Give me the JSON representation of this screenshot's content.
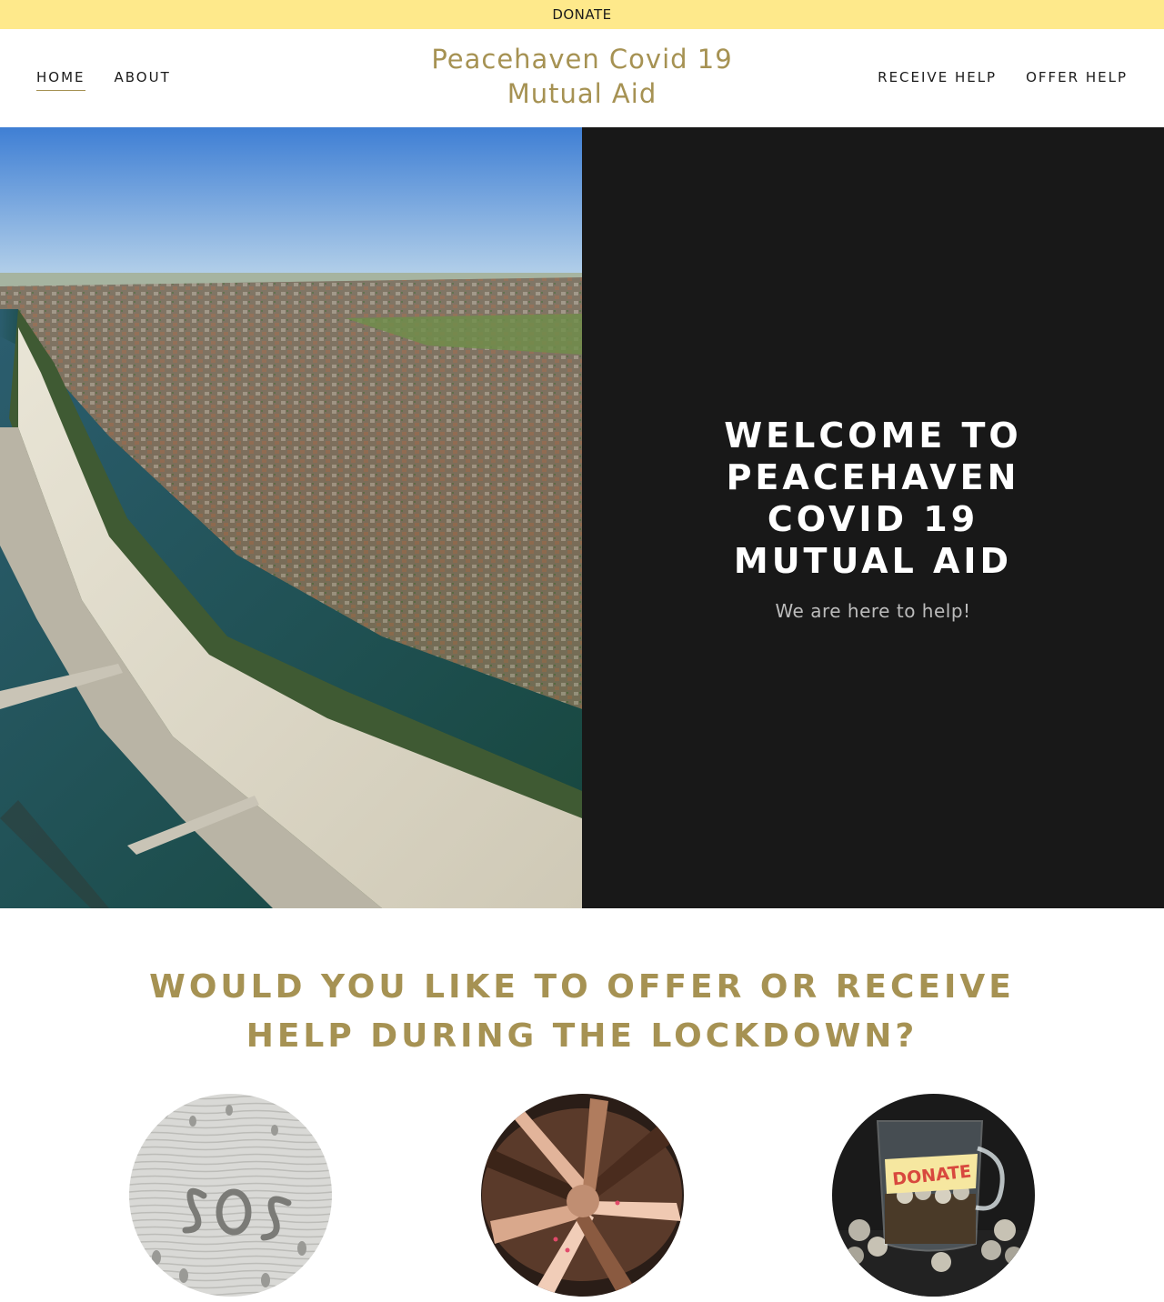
{
  "donate_bar": {
    "label": "DONATE"
  },
  "header": {
    "nav_left": [
      {
        "label": "HOME",
        "active": true
      },
      {
        "label": "ABOUT",
        "active": false
      }
    ],
    "title_line1": "Peacehaven Covid 19",
    "title_line2": "Mutual Aid",
    "nav_right": [
      {
        "label": "RECEIVE HELP"
      },
      {
        "label": "OFFER HELP"
      }
    ]
  },
  "hero": {
    "heading": "WELCOME TO PEACEHAVEN COVID 19 MUTUAL AID",
    "subtitle": "We are here to help!"
  },
  "section": {
    "heading": "WOULD YOU LIKE TO OFFER OR RECEIVE HELP DURING THE LOCKDOWN?",
    "images": [
      {
        "name": "sos-in-sand",
        "sand_text": "SOS"
      },
      {
        "name": "joined-hands"
      },
      {
        "name": "donation-jar",
        "jar_label": "DONATE"
      }
    ]
  },
  "colors": {
    "donate_bar_bg": "#fee98b",
    "accent_gold": "#a69253",
    "hero_panel_bg": "#181818"
  }
}
